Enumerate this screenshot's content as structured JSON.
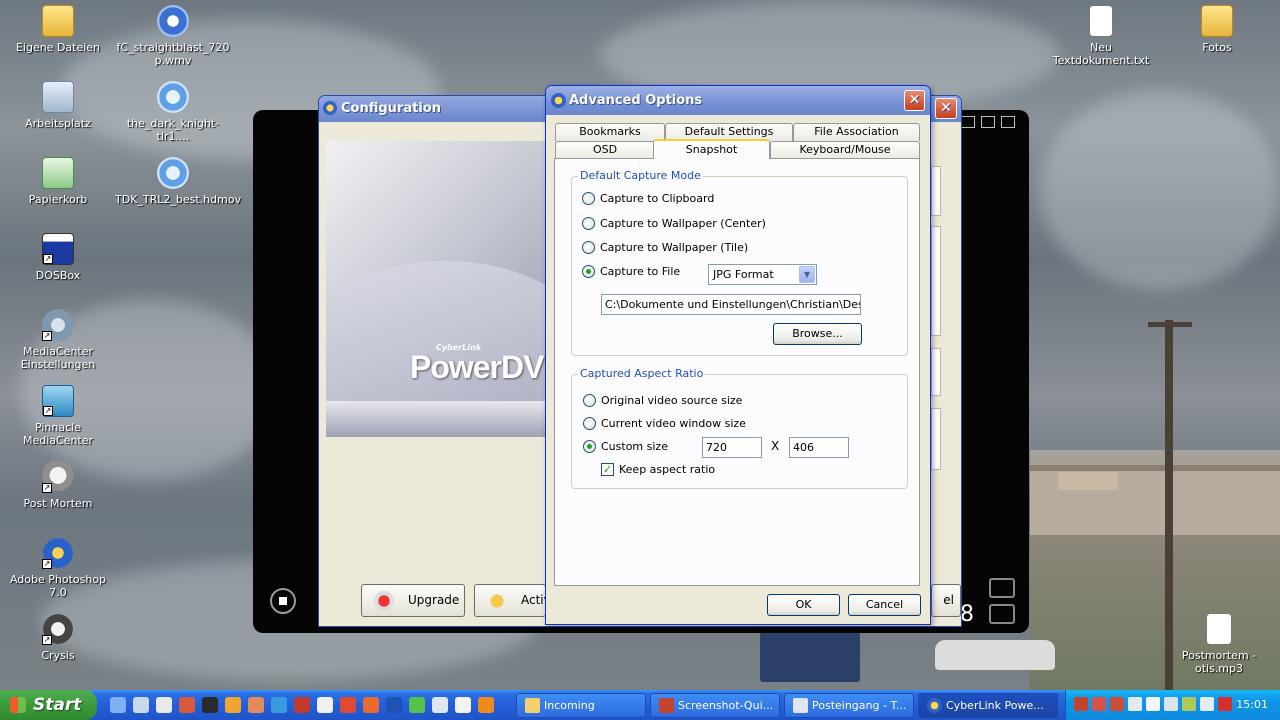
{
  "desktop": {
    "icons_left": [
      {
        "label": "Eigene Dateien",
        "icon": "folder-icon"
      },
      {
        "label": "Arbeitsplatz",
        "icon": "computer-icon"
      },
      {
        "label": "Papierkorb",
        "icon": "recycle-bin-icon"
      },
      {
        "label": "DOSBox",
        "icon": "dosbox-icon"
      },
      {
        "label": "MediaCenter Einstellungen",
        "icon": "gear-icon"
      },
      {
        "label": "Pinnacle MediaCenter",
        "icon": "pinnacle-icon"
      },
      {
        "label": "Post Mortem",
        "icon": "alien-icon"
      },
      {
        "label": "Adobe Photoshop 7.0",
        "icon": "photoshop-icon"
      },
      {
        "label": "Crysis",
        "icon": "crysis-icon"
      }
    ],
    "icons_col2": [
      {
        "label": "fC_straightblast_720p.wmv",
        "icon": "media-file-icon"
      },
      {
        "label": "the_dark_knight-tlr1....",
        "icon": "quicktime-icon"
      },
      {
        "label": "TDK_TRL2_best.hdmov",
        "icon": "quicktime-icon"
      }
    ],
    "icons_right": [
      {
        "label": "Neu Textdokument.txt",
        "icon": "text-file-icon"
      },
      {
        "label": "Fotos",
        "icon": "folder-icon"
      },
      {
        "label": "Postmortem - otis.mp3",
        "icon": "audio-file-icon"
      }
    ]
  },
  "player": {
    "counter": "8"
  },
  "configuration": {
    "title": "Configuration",
    "banner_small": "CyberLink",
    "banner_brand": "PowerDV",
    "upgrade_label": "Upgrade",
    "activate_label": "Activ",
    "partial_button": "el"
  },
  "advanced": {
    "title": "Advanced Options",
    "tabs_row1": [
      "Bookmarks",
      "Default Settings",
      "File Association"
    ],
    "tabs_row2": [
      "OSD",
      "Snapshot",
      "Keyboard/Mouse"
    ],
    "active_tab": "Snapshot",
    "capture_mode": {
      "legend": "Default Capture Mode",
      "options": [
        "Capture to Clipboard",
        "Capture to Wallpaper (Center)",
        "Capture to Wallpaper (Tile)",
        "Capture to File"
      ],
      "selected": "Capture to File",
      "format_value": "JPG Format",
      "path_value": "C:\\Dokumente und Einstellungen\\Christian\\Desktop\\",
      "browse_label": "Browse..."
    },
    "aspect": {
      "legend": "Captured Aspect Ratio",
      "options": [
        "Original video source size",
        "Current video window size",
        "Custom size"
      ],
      "selected": "Custom size",
      "width_value": "720",
      "separator": "X",
      "height_value": "406",
      "keep_label": "Keep aspect ratio",
      "keep_checked": true
    },
    "ok_label": "OK",
    "cancel_label": "Cancel"
  },
  "taskbar": {
    "start_label": "Start",
    "tasks": [
      {
        "label": "Incoming",
        "icon": "folder-icon"
      },
      {
        "label": "Screenshot-Qui...",
        "icon": "app-icon"
      },
      {
        "label": "Posteingang - T...",
        "icon": "mail-icon"
      },
      {
        "label": "CyberLink Powe...",
        "icon": "powerdvd-icon"
      }
    ],
    "clock": "15:01"
  }
}
